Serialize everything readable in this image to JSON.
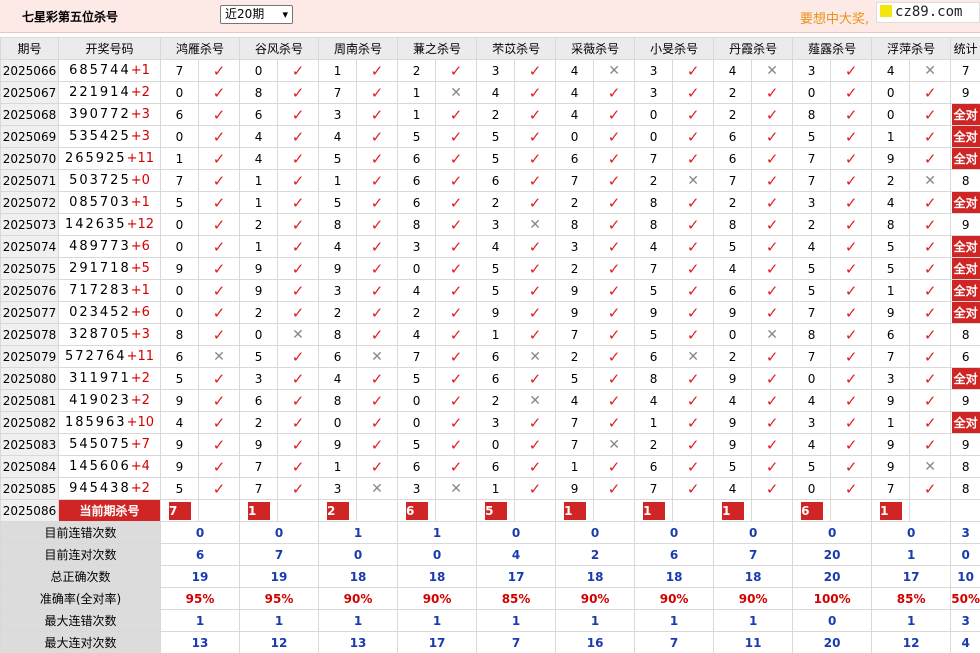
{
  "title": "七星彩第五位杀号",
  "period_select": "近20期",
  "ad_text": "要想中大奖,",
  "brand": "cz89.com",
  "headers": {
    "issue": "期号",
    "draw": "开奖号码",
    "experts": [
      "鸿雁杀号",
      "谷风杀号",
      "周南杀号",
      "蒹之杀号",
      "芣苡杀号",
      "采薇杀号",
      "小旻杀号",
      "丹霞杀号",
      "薤露杀号",
      "浮萍杀号"
    ],
    "stat": "统计"
  },
  "rows": [
    {
      "issue": "2025066",
      "digits": "685744",
      "plus": "+1",
      "k": [
        "7",
        "0",
        "1",
        "2",
        "3",
        "4",
        "3",
        "4",
        "3",
        "4"
      ],
      "ok": [
        1,
        1,
        1,
        1,
        1,
        0,
        1,
        0,
        1,
        0
      ],
      "stat": "7"
    },
    {
      "issue": "2025067",
      "digits": "221914",
      "plus": "+2",
      "k": [
        "0",
        "8",
        "7",
        "1",
        "4",
        "4",
        "3",
        "2",
        "0",
        "0"
      ],
      "ok": [
        1,
        1,
        1,
        0,
        1,
        1,
        1,
        1,
        1,
        1
      ],
      "stat": "9"
    },
    {
      "issue": "2025068",
      "digits": "390772",
      "plus": "+3",
      "k": [
        "6",
        "6",
        "3",
        "1",
        "2",
        "4",
        "0",
        "2",
        "8",
        "0"
      ],
      "ok": [
        1,
        1,
        1,
        1,
        1,
        1,
        1,
        1,
        1,
        1
      ],
      "stat": "全对"
    },
    {
      "issue": "2025069",
      "digits": "535425",
      "plus": "+3",
      "k": [
        "0",
        "4",
        "4",
        "5",
        "5",
        "0",
        "0",
        "6",
        "5",
        "1"
      ],
      "ok": [
        1,
        1,
        1,
        1,
        1,
        1,
        1,
        1,
        1,
        1
      ],
      "stat": "全对"
    },
    {
      "issue": "2025070",
      "digits": "265925",
      "plus": "+11",
      "k": [
        "1",
        "4",
        "5",
        "6",
        "5",
        "6",
        "7",
        "6",
        "7",
        "9"
      ],
      "ok": [
        1,
        1,
        1,
        1,
        1,
        1,
        1,
        1,
        1,
        1
      ],
      "stat": "全对"
    },
    {
      "issue": "2025071",
      "digits": "503725",
      "plus": "+0",
      "k": [
        "7",
        "1",
        "1",
        "6",
        "6",
        "7",
        "2",
        "7",
        "7",
        "2"
      ],
      "ok": [
        1,
        1,
        1,
        1,
        1,
        1,
        0,
        1,
        1,
        0
      ],
      "stat": "8"
    },
    {
      "issue": "2025072",
      "digits": "085703",
      "plus": "+1",
      "k": [
        "5",
        "1",
        "5",
        "6",
        "2",
        "2",
        "8",
        "2",
        "3",
        "4"
      ],
      "ok": [
        1,
        1,
        1,
        1,
        1,
        1,
        1,
        1,
        1,
        1
      ],
      "stat": "全对"
    },
    {
      "issue": "2025073",
      "digits": "142635",
      "plus": "+12",
      "k": [
        "0",
        "2",
        "8",
        "8",
        "3",
        "8",
        "8",
        "8",
        "2",
        "8"
      ],
      "ok": [
        1,
        1,
        1,
        1,
        0,
        1,
        1,
        1,
        1,
        1
      ],
      "stat": "9"
    },
    {
      "issue": "2025074",
      "digits": "489773",
      "plus": "+6",
      "k": [
        "0",
        "1",
        "4",
        "3",
        "4",
        "3",
        "4",
        "5",
        "4",
        "5"
      ],
      "ok": [
        1,
        1,
        1,
        1,
        1,
        1,
        1,
        1,
        1,
        1
      ],
      "stat": "全对"
    },
    {
      "issue": "2025075",
      "digits": "291718",
      "plus": "+5",
      "k": [
        "9",
        "9",
        "9",
        "0",
        "5",
        "2",
        "7",
        "4",
        "5",
        "5"
      ],
      "ok": [
        1,
        1,
        1,
        1,
        1,
        1,
        1,
        1,
        1,
        1
      ],
      "stat": "全对"
    },
    {
      "issue": "2025076",
      "digits": "717283",
      "plus": "+1",
      "k": [
        "0",
        "9",
        "3",
        "4",
        "5",
        "9",
        "5",
        "6",
        "5",
        "1"
      ],
      "ok": [
        1,
        1,
        1,
        1,
        1,
        1,
        1,
        1,
        1,
        1
      ],
      "stat": "全对"
    },
    {
      "issue": "2025077",
      "digits": "023452",
      "plus": "+6",
      "k": [
        "0",
        "2",
        "2",
        "2",
        "9",
        "9",
        "9",
        "9",
        "7",
        "9"
      ],
      "ok": [
        1,
        1,
        1,
        1,
        1,
        1,
        1,
        1,
        1,
        1
      ],
      "stat": "全对"
    },
    {
      "issue": "2025078",
      "digits": "328705",
      "plus": "+3",
      "k": [
        "8",
        "0",
        "8",
        "4",
        "1",
        "7",
        "5",
        "0",
        "8",
        "6"
      ],
      "ok": [
        1,
        0,
        1,
        1,
        1,
        1,
        1,
        0,
        1,
        1
      ],
      "stat": "8"
    },
    {
      "issue": "2025079",
      "digits": "572764",
      "plus": "+11",
      "k": [
        "6",
        "5",
        "6",
        "7",
        "6",
        "2",
        "6",
        "2",
        "7",
        "7"
      ],
      "ok": [
        0,
        1,
        0,
        1,
        0,
        1,
        0,
        1,
        1,
        1
      ],
      "stat": "6"
    },
    {
      "issue": "2025080",
      "digits": "311971",
      "plus": "+2",
      "k": [
        "5",
        "3",
        "4",
        "5",
        "6",
        "5",
        "8",
        "9",
        "0",
        "3"
      ],
      "ok": [
        1,
        1,
        1,
        1,
        1,
        1,
        1,
        1,
        1,
        1
      ],
      "stat": "全对"
    },
    {
      "issue": "2025081",
      "digits": "419023",
      "plus": "+2",
      "k": [
        "9",
        "6",
        "8",
        "0",
        "2",
        "4",
        "4",
        "4",
        "4",
        "9"
      ],
      "ok": [
        1,
        1,
        1,
        1,
        0,
        1,
        1,
        1,
        1,
        1
      ],
      "stat": "9"
    },
    {
      "issue": "2025082",
      "digits": "185963",
      "plus": "+10",
      "k": [
        "4",
        "2",
        "0",
        "0",
        "3",
        "7",
        "1",
        "9",
        "3",
        "1"
      ],
      "ok": [
        1,
        1,
        1,
        1,
        1,
        1,
        1,
        1,
        1,
        1
      ],
      "stat": "全对"
    },
    {
      "issue": "2025083",
      "digits": "545075",
      "plus": "+7",
      "k": [
        "9",
        "9",
        "9",
        "5",
        "0",
        "7",
        "2",
        "9",
        "4",
        "9"
      ],
      "ok": [
        1,
        1,
        1,
        1,
        1,
        0,
        1,
        1,
        1,
        1
      ],
      "stat": "9"
    },
    {
      "issue": "2025084",
      "digits": "145606",
      "plus": "+4",
      "k": [
        "9",
        "7",
        "1",
        "6",
        "6",
        "1",
        "6",
        "5",
        "5",
        "9"
      ],
      "ok": [
        1,
        1,
        1,
        1,
        1,
        1,
        1,
        1,
        1,
        0
      ],
      "stat": "8"
    },
    {
      "issue": "2025085",
      "digits": "945438",
      "plus": "+2",
      "k": [
        "5",
        "7",
        "3",
        "3",
        "1",
        "9",
        "7",
        "4",
        "0",
        "7"
      ],
      "ok": [
        1,
        1,
        0,
        0,
        1,
        1,
        1,
        1,
        1,
        1
      ],
      "stat": "8"
    }
  ],
  "current": {
    "issue": "2025086",
    "label": "当前期杀号",
    "k": [
      "7",
      "1",
      "2",
      "6",
      "5",
      "1",
      "1",
      "1",
      "6",
      "1"
    ]
  },
  "stats": [
    {
      "label": "目前连错次数",
      "vals": [
        "0",
        "0",
        "1",
        "1",
        "0",
        "0",
        "0",
        "0",
        "0",
        "0"
      ],
      "stat": "3",
      "red": false
    },
    {
      "label": "目前连对次数",
      "vals": [
        "6",
        "7",
        "0",
        "0",
        "4",
        "2",
        "6",
        "7",
        "20",
        "1"
      ],
      "stat": "0",
      "red": false
    },
    {
      "label": "总正确次数",
      "vals": [
        "19",
        "19",
        "18",
        "18",
        "17",
        "18",
        "18",
        "18",
        "20",
        "17"
      ],
      "stat": "10",
      "red": false
    },
    {
      "label": "准确率(全对率)",
      "vals": [
        "95%",
        "95%",
        "90%",
        "90%",
        "85%",
        "90%",
        "90%",
        "90%",
        "100%",
        "85%"
      ],
      "stat": "50%",
      "red": true
    },
    {
      "label": "最大连错次数",
      "vals": [
        "1",
        "1",
        "1",
        "1",
        "1",
        "1",
        "1",
        "1",
        "0",
        "1"
      ],
      "stat": "3",
      "red": false
    },
    {
      "label": "最大连对次数",
      "vals": [
        "13",
        "12",
        "13",
        "17",
        "7",
        "16",
        "7",
        "11",
        "20",
        "12"
      ],
      "stat": "4",
      "red": false
    }
  ],
  "icons": {
    "ok": "check-icon",
    "bad": "cross-icon",
    "select": "chevron-down-icon"
  },
  "colors": {
    "accent_red": "#cf2525",
    "check_red": "#e02020",
    "stat_blue": "#1a3bb0",
    "header_pink": "#fde9e5"
  }
}
